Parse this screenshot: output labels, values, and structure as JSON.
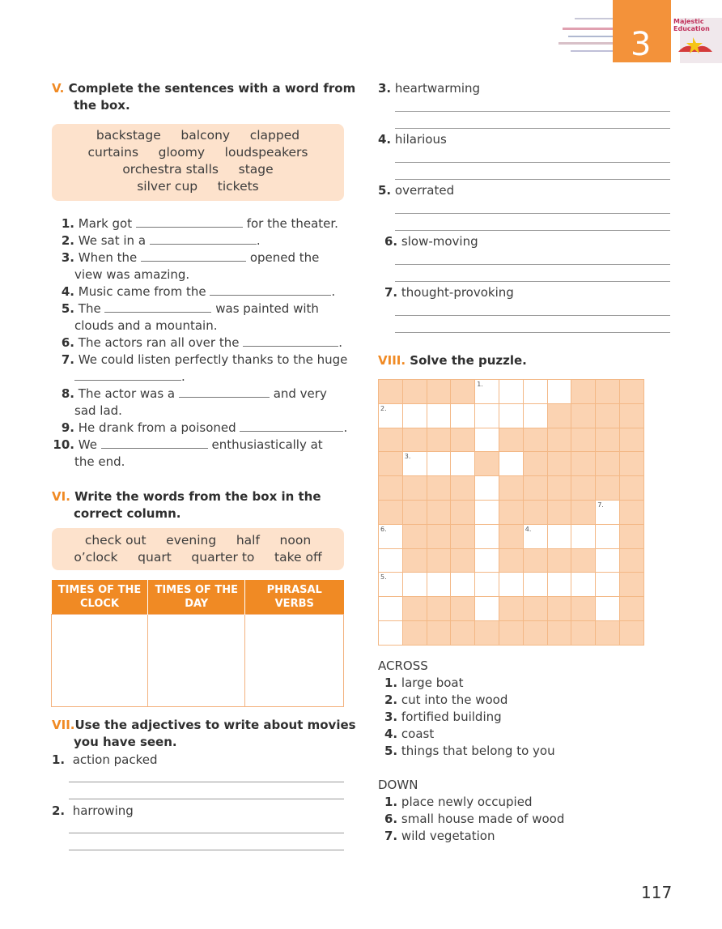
{
  "header": {
    "unit_number": "3",
    "logo_text_1": "Majestic",
    "logo_text_2": "Education"
  },
  "section5": {
    "numeral": "V.",
    "title_line1": "Complete the sentences with a word from",
    "title_line2": "the box.",
    "box_lines": [
      "backstage     balcony     clapped",
      "curtains     gloomy     loudspeakers",
      "orchestra stalls     stage",
      "silver cup     tickets"
    ],
    "items": [
      {
        "n": "1.",
        "a": "Mark got",
        "b": "for the theater."
      },
      {
        "n": "2.",
        "a": "We sat in a",
        "b": "."
      },
      {
        "n": "3.",
        "a": "When the",
        "b": "opened the"
      },
      {
        "n": "",
        "a": "view was amazing.",
        "b": ""
      },
      {
        "n": "4.",
        "a": "Music came from the",
        "b": "."
      },
      {
        "n": "5.",
        "a": "The",
        "b": "was painted with"
      },
      {
        "n": "",
        "a": "clouds and a mountain.",
        "b": ""
      },
      {
        "n": "6.",
        "a": "The actors ran all over the",
        "b": "."
      },
      {
        "n": "7.",
        "a": "We could listen perfectly thanks to the huge",
        "b": ""
      },
      {
        "n": "",
        "a": "",
        "b": "."
      },
      {
        "n": "8.",
        "a": "The actor was a",
        "b": "and very"
      },
      {
        "n": "",
        "a": "sad lad.",
        "b": ""
      },
      {
        "n": "9.",
        "a": "He drank from a poisoned",
        "b": "."
      },
      {
        "n": "10.",
        "a": "We",
        "b": "enthusiastically at"
      },
      {
        "n": "",
        "a": "the end.",
        "b": ""
      }
    ]
  },
  "section6": {
    "numeral": "VI.",
    "title_line1": "Write the words from the box in the",
    "title_line2": "correct column.",
    "box_lines": [
      "check out     evening     half     noon",
      "o’clock     quart     quarter to     take off"
    ],
    "columns": [
      "TIMES OF THE CLOCK",
      "TIMES OF THE DAY",
      "PHRASAL VERBS"
    ]
  },
  "section7": {
    "numeral": "VII.",
    "title_line1": "Use the adjectives to write about movies",
    "title_line2": "you have seen.",
    "items_left": [
      {
        "n": "1.",
        "text": "action packed"
      },
      {
        "n": "2.",
        "text": "harrowing"
      }
    ],
    "items_right": [
      {
        "n": "3.",
        "text": "heartwarming"
      },
      {
        "n": "4.",
        "text": "hilarious"
      },
      {
        "n": "5.",
        "text": "overrated"
      },
      {
        "n": "6.",
        "text": "slow-moving"
      },
      {
        "n": "7.",
        "text": "thought-provoking"
      }
    ]
  },
  "section8": {
    "numeral": "VIII.",
    "title": "Solve the puzzle.",
    "grid_numbers": [
      "1.",
      "2.",
      "3.",
      "7.",
      "6.",
      "4.",
      "5."
    ],
    "across_label": "ACROSS",
    "across": [
      {
        "n": "1.",
        "text": "large boat"
      },
      {
        "n": "2.",
        "text": "cut into the wood"
      },
      {
        "n": "3.",
        "text": "fortified building"
      },
      {
        "n": "4.",
        "text": "coast"
      },
      {
        "n": "5.",
        "text": "things that belong to you"
      }
    ],
    "down_label": "DOWN",
    "down": [
      {
        "n": "1.",
        "text": "place newly occupied"
      },
      {
        "n": "6.",
        "text": "small house made of wood"
      },
      {
        "n": "7.",
        "text": "wild vegetation"
      }
    ]
  },
  "footer": {
    "page_number": "117"
  }
}
